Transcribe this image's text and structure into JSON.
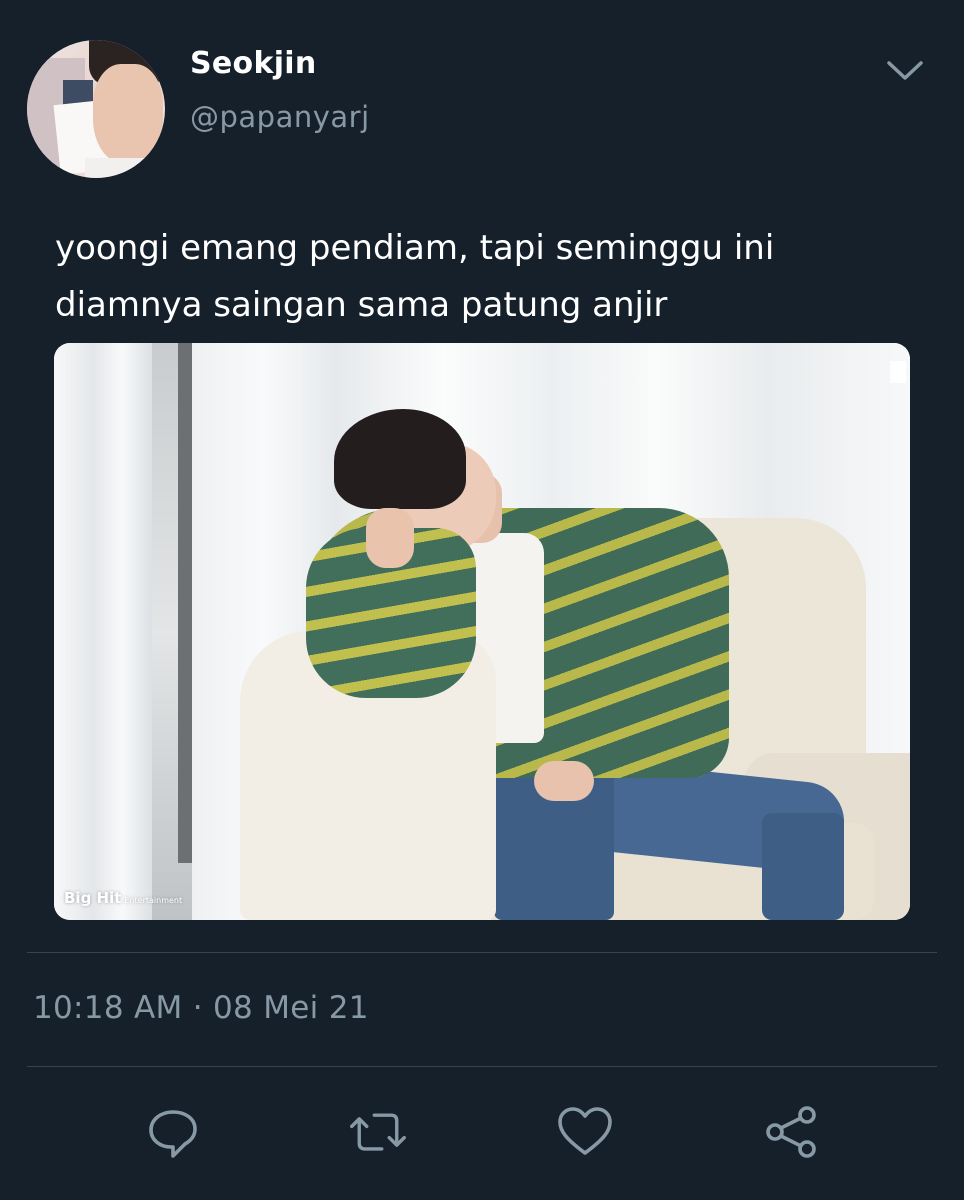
{
  "user": {
    "display_name": "Seokjin",
    "handle": "@papanyarj"
  },
  "header": {
    "menu_icon": "chevron-down-icon"
  },
  "tweet": {
    "text_lines": [
      "yoongi emang pendiam, tapi seminggu ini",
      "diamnya saingan sama patung anjir"
    ],
    "media": {
      "watermark_brand": "Big Hit",
      "watermark_sub": "Entertainment"
    },
    "timestamp": "10:18 AM · 08 Mei 21"
  },
  "actions": [
    {
      "name": "reply",
      "icon": "reply-icon"
    },
    {
      "name": "retweet",
      "icon": "retweet-icon"
    },
    {
      "name": "like",
      "icon": "heart-icon"
    },
    {
      "name": "share",
      "icon": "share-icon"
    }
  ],
  "colors": {
    "background": "#15202b",
    "secondary_text": "#8899a6",
    "divider": "#38444d",
    "icon": "#8899a6"
  }
}
